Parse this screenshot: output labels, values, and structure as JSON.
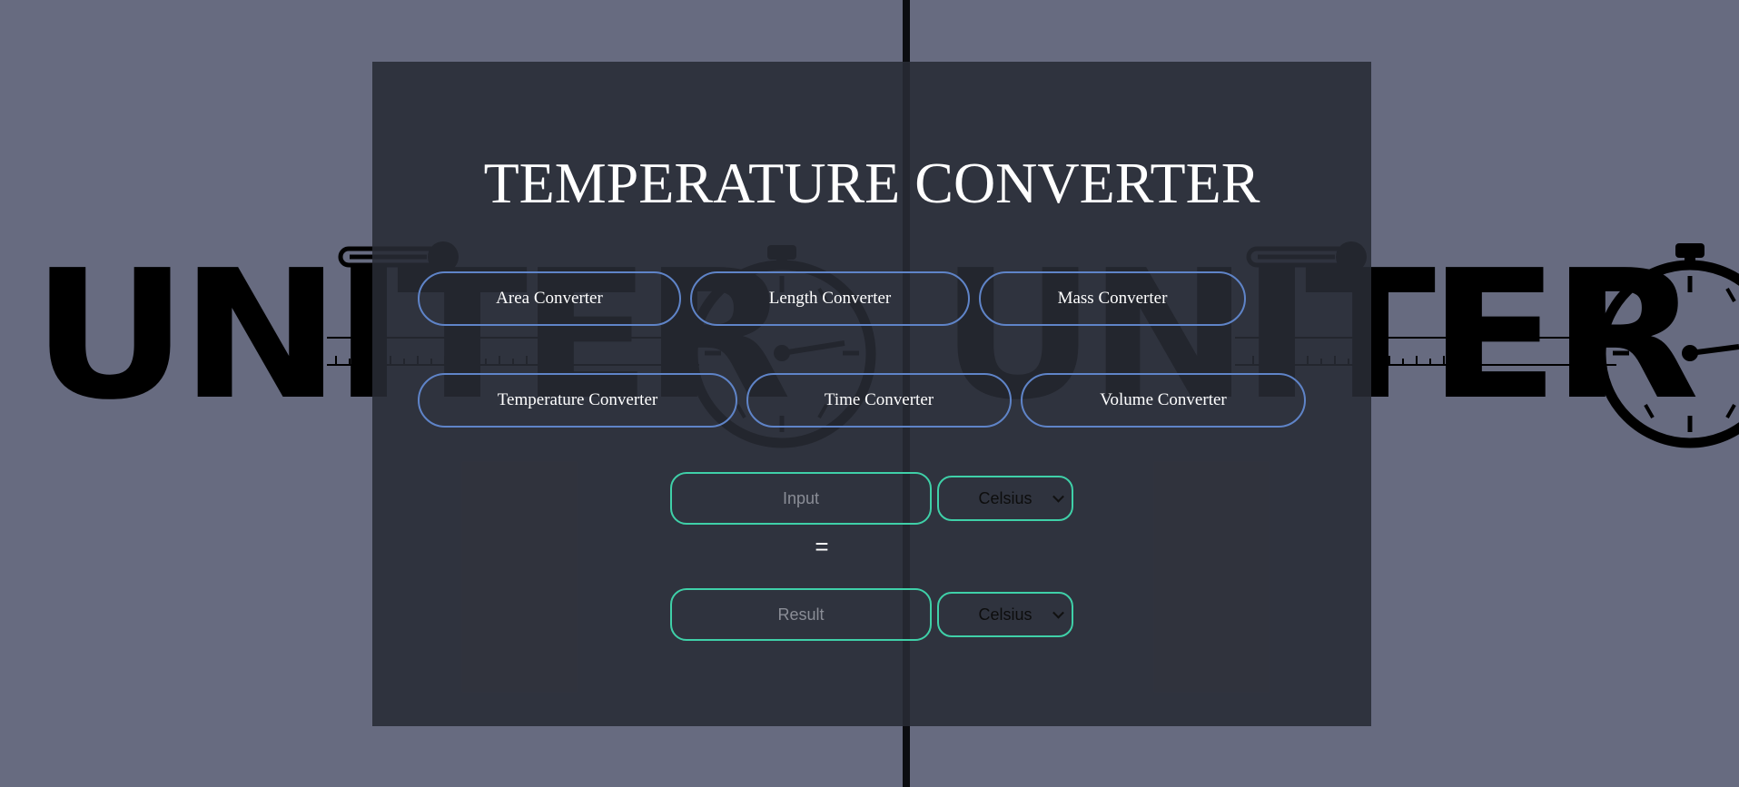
{
  "page": {
    "title": "TEMPERATURE CONVERTER"
  },
  "background": {
    "logo_text_left": "UNITER",
    "logo_text_right": "UNITER",
    "logo_icons": [
      "thermometer-icon",
      "stopwatch-icon",
      "ruler-icon"
    ]
  },
  "nav": {
    "area": "Area Converter",
    "length": "Length Converter",
    "mass": "Mass Converter",
    "temperature": "Temperature Converter",
    "time": "Time Converter",
    "volume": "Volume Converter"
  },
  "converter": {
    "input_placeholder": "Input",
    "input_value": "",
    "from_unit": "Celsius",
    "equals": "=",
    "result_placeholder": "Result",
    "result_value": "",
    "to_unit": "Celsius"
  },
  "colors": {
    "page_background": "#676b80",
    "panel": "#282b34",
    "nav_border": "#5f84c8",
    "field_border": "#3fd0a8",
    "text": "#ffffff"
  }
}
